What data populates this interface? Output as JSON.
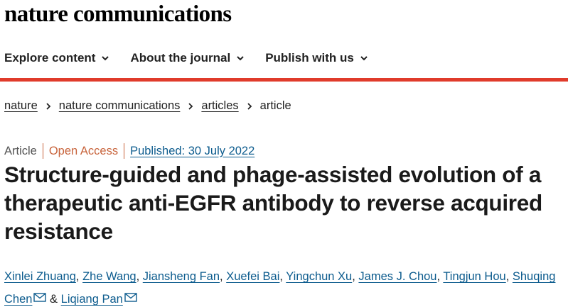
{
  "site": {
    "brand": "nature communications"
  },
  "nav": {
    "items": [
      {
        "label": "Explore content"
      },
      {
        "label": "About the journal"
      },
      {
        "label": "Publish with us"
      }
    ]
  },
  "breadcrumb": {
    "items": [
      "nature",
      "nature communications",
      "articles"
    ],
    "current": "article"
  },
  "article": {
    "type": "Article",
    "access": "Open Access",
    "published": "Published: 30 July 2022",
    "title": "Structure-guided and phage-assisted evolution of a therapeutic anti-EGFR antibody to reverse acquired resistance",
    "authors": [
      "Xinlei Zhuang",
      "Zhe Wang",
      "Jiansheng Fan",
      "Xuefei Bai",
      "Yingchun Xu",
      "James J. Chou",
      "Tingjun Hou",
      "Shuqing Chen",
      "Liqiang Pan"
    ],
    "authors_and": "&"
  },
  "colors": {
    "accent_red": "#e03b2b",
    "link_blue": "#0d5c8e",
    "open_access": "#c8643c"
  }
}
